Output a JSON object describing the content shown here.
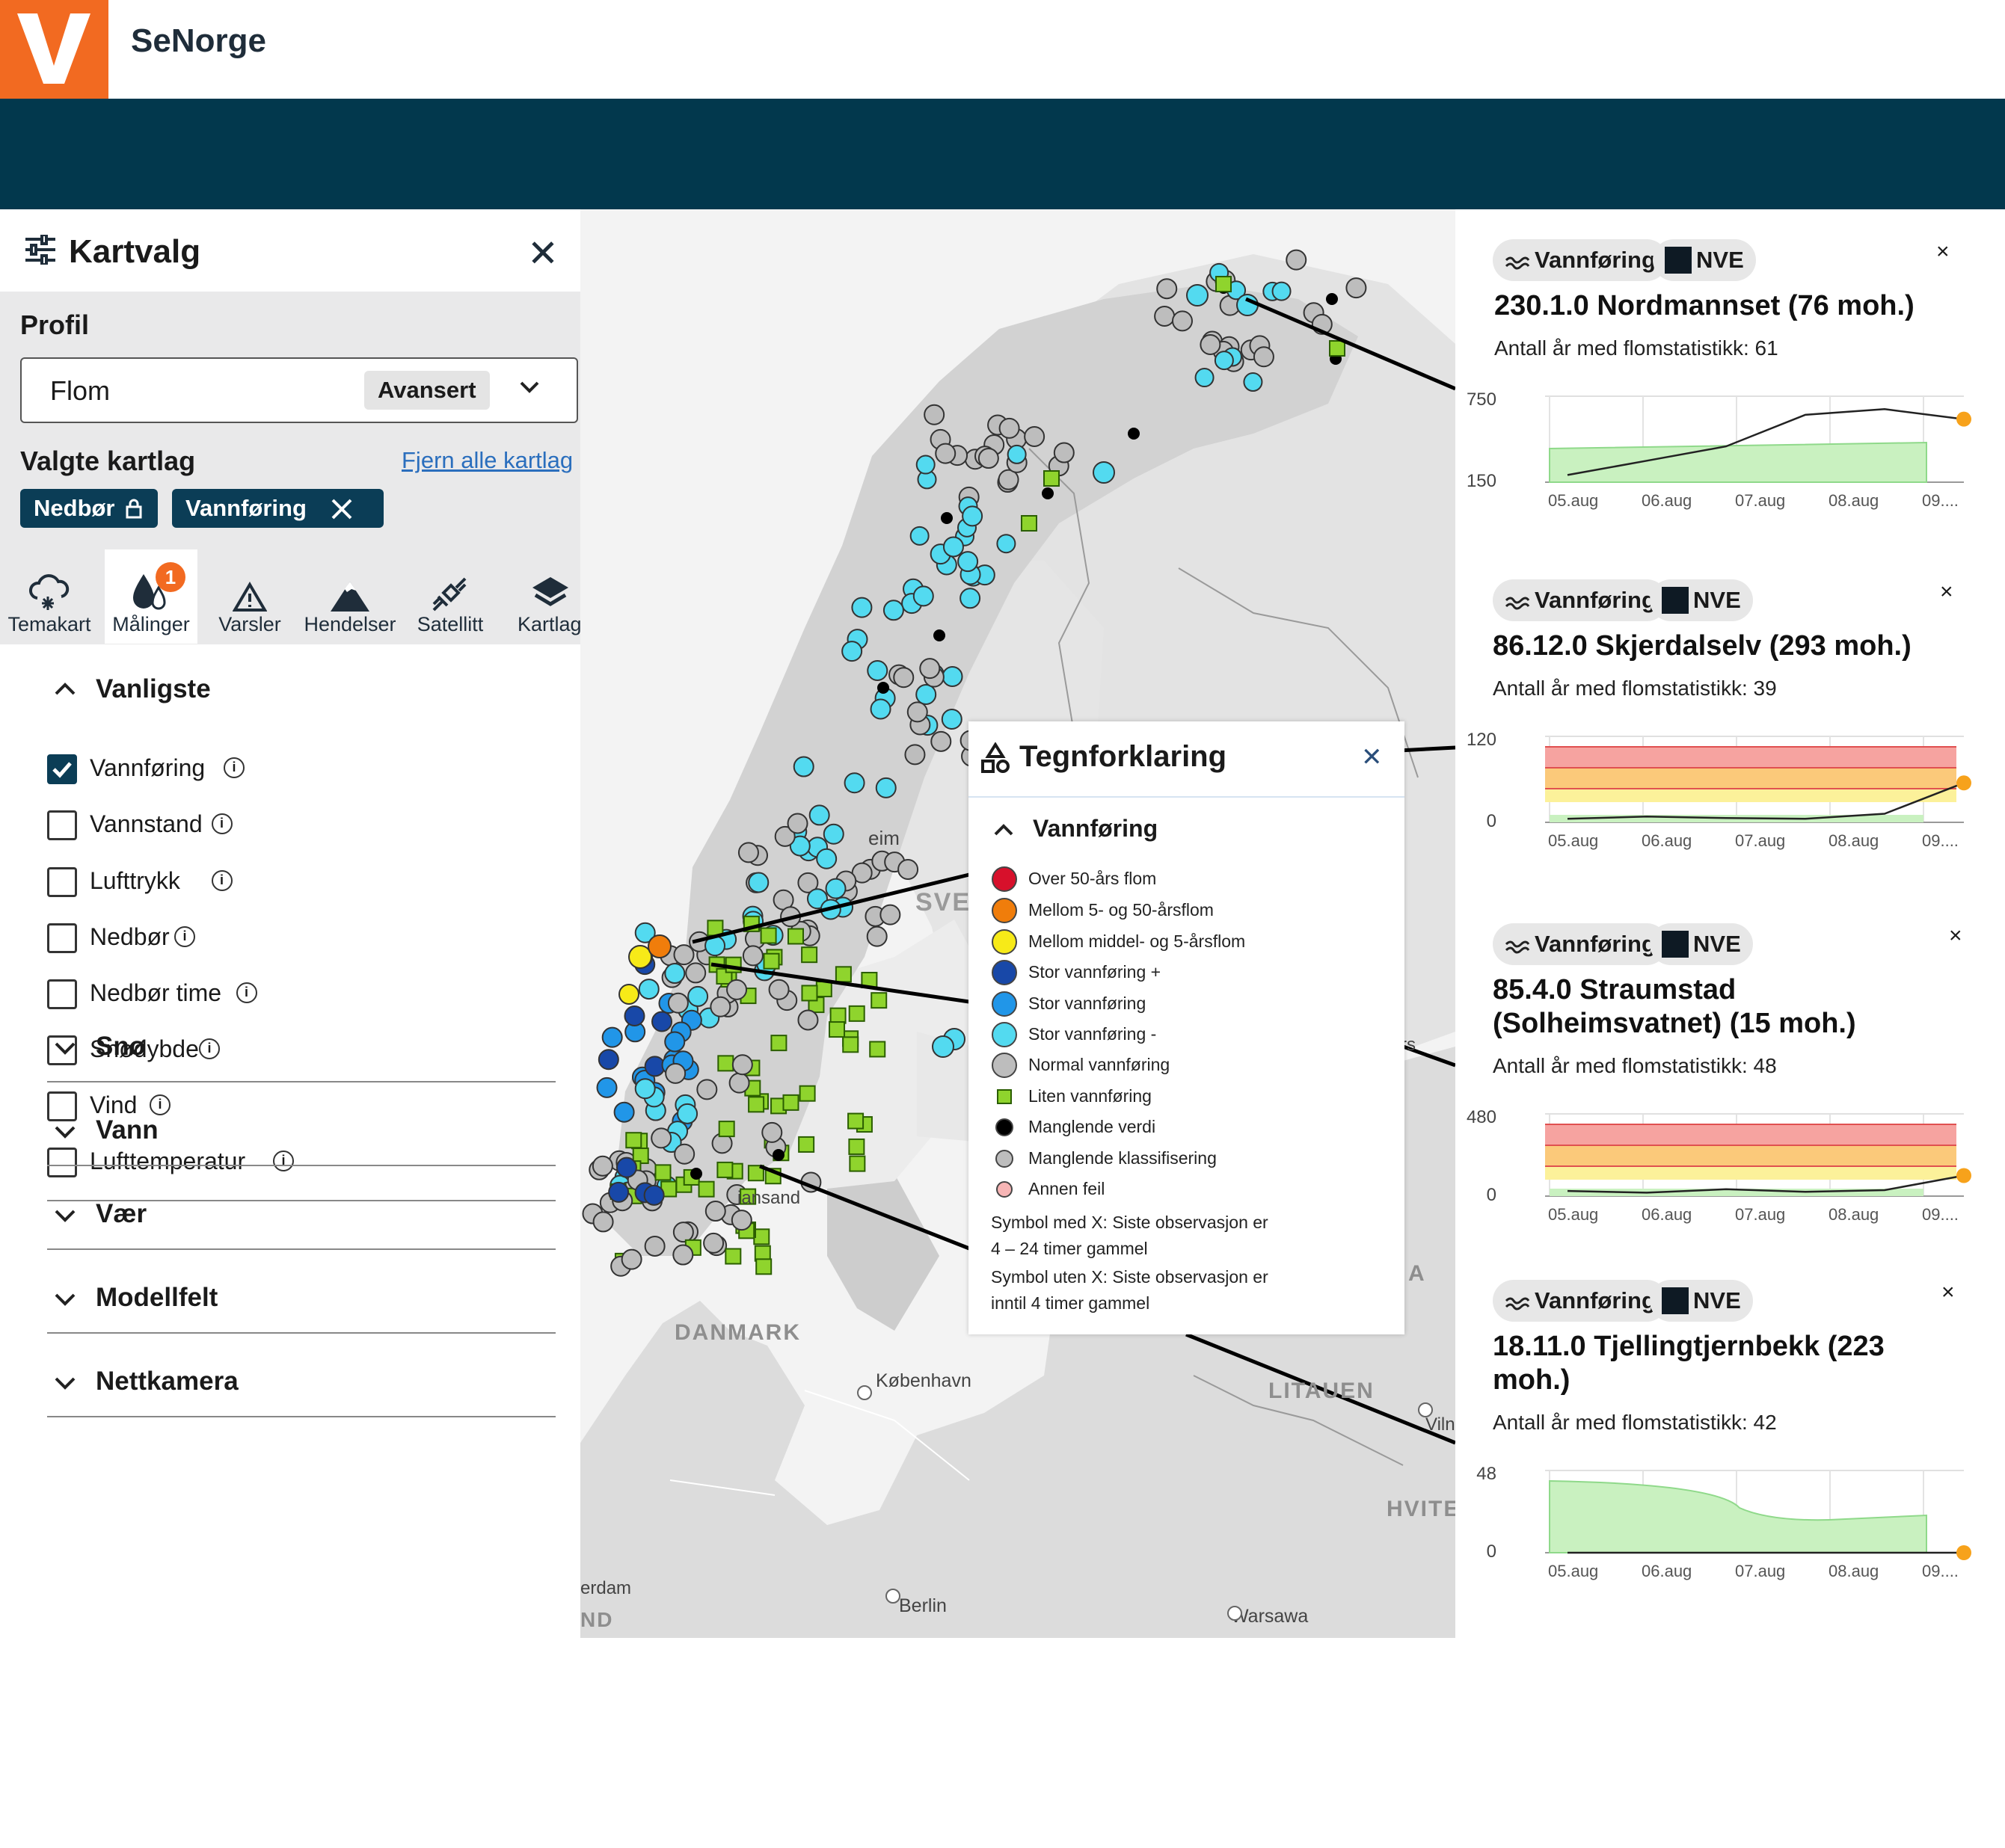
{
  "app": {
    "title": "SeNorge"
  },
  "sidebar": {
    "title": "Kartvalg",
    "profile_label": "Profil",
    "profile_value": "Flom",
    "profile_mode": "Avansert",
    "selected_layers_label": "Valgte kartlag",
    "remove_all": "Fjern alle kartlag",
    "chips": [
      {
        "label": "Nedbør"
      },
      {
        "label": "Vannføring"
      }
    ],
    "tabs": [
      {
        "label": "Temakart",
        "icon": "cloud-snow-icon"
      },
      {
        "label": "Målinger",
        "icon": "drops-icon",
        "badge": "1"
      },
      {
        "label": "Varsler",
        "icon": "warning-icon"
      },
      {
        "label": "Hendelser",
        "icon": "mountain-icon"
      },
      {
        "label": "Satellitt",
        "icon": "satellite-icon"
      },
      {
        "label": "Kartlag",
        "icon": "layers-icon"
      }
    ],
    "common_section": "Vanligste",
    "options": [
      {
        "label": "Vannføring",
        "checked": true
      },
      {
        "label": "Vannstand",
        "checked": false
      },
      {
        "label": "Lufttrykk",
        "checked": false
      },
      {
        "label": "Nedbør",
        "checked": false
      },
      {
        "label": "Nedbør time",
        "checked": false
      },
      {
        "label": "Snødybde",
        "checked": false
      },
      {
        "label": "Vind",
        "checked": false
      },
      {
        "label": "Lufttemperatur",
        "checked": false
      }
    ],
    "sections": [
      "Snø",
      "Vann",
      "Vær",
      "Modellfelt",
      "Nettkamera"
    ]
  },
  "map": {
    "labels": [
      "SVEI",
      "eim",
      "DANMARK",
      "København",
      "LITAUEN",
      "Vilnius",
      "HVITE",
      "Berlin",
      "Warsawa",
      "erdam",
      "ND",
      "iansand",
      "rs",
      "A"
    ]
  },
  "legend": {
    "title": "Tegnforklaring",
    "section": "Vannføring",
    "items": [
      {
        "label": "Over 50-års flom",
        "color": "#d7102b"
      },
      {
        "label": "Mellom 5- og 50-årsflom",
        "color": "#f07d0b"
      },
      {
        "label": "Mellom middel- og 5-årsflom",
        "color": "#f7ea18"
      },
      {
        "label": "Stor vannføring +",
        "color": "#1848a8"
      },
      {
        "label": "Stor vannføring",
        "color": "#2196e8"
      },
      {
        "label": "Stor vannføring -",
        "color": "#53daf0"
      },
      {
        "label": "Normal vannføring",
        "color": "#bdbdbd"
      },
      {
        "label": "Liten vannføring",
        "color": "#8fd42d"
      },
      {
        "label": "Manglende verdi",
        "color": "#000000"
      },
      {
        "label": "Manglende klassifisering",
        "color": "#bdbdbd"
      },
      {
        "label": "Annen feil",
        "color": "#f7b5b5"
      }
    ],
    "note1_line1": "Symbol med X: Siste observasjon er",
    "note1_line2": "4 – 24 timer gammel",
    "note2_line1": "Symbol uten X: Siste observasjon er",
    "note2_line2": "inntil 4 timer gammel"
  },
  "panels": [
    {
      "type": "Vannføring",
      "source": "NVE",
      "title_lines": [
        "230.1.0 Nordmannset (76 moh.)"
      ],
      "stat": "Antall år med flomstatistikk: 61",
      "ymax": "750",
      "ymin": "150",
      "dates": [
        "05.aug",
        "06.aug",
        "07.aug",
        "08.aug",
        "09...."
      ]
    },
    {
      "type": "Vannføring",
      "source": "NVE",
      "title_lines": [
        "86.12.0 Skjerdalselv (293 moh.)"
      ],
      "stat": "Antall år med flomstatistikk: 39",
      "ymax": "120",
      "ymin": "0",
      "dates": [
        "05.aug",
        "06.aug",
        "07.aug",
        "08.aug",
        "09...."
      ]
    },
    {
      "type": "Vannføring",
      "source": "NVE",
      "title_lines": [
        "85.4.0 Straumstad",
        "(Solheimsvatnet) (15 moh.)"
      ],
      "stat": "Antall år med flomstatistikk: 48",
      "ymax": "480",
      "ymin": "0",
      "dates": [
        "05.aug",
        "06.aug",
        "07.aug",
        "08.aug",
        "09...."
      ]
    },
    {
      "type": "Vannføring",
      "source": "NVE",
      "title_lines": [
        "18.11.0 Tjellingtjernbekk (223",
        "moh.)"
      ],
      "stat": "Antall år med flomstatistikk: 42",
      "ymax": "48",
      "ymin": "0",
      "dates": [
        "05.aug",
        "06.aug",
        "07.aug",
        "08.aug",
        "09...."
      ]
    }
  ],
  "chart_data": [
    {
      "type": "line",
      "title": "230.1.0 Nordmannset (76 moh.)",
      "ylim": [
        150,
        750
      ],
      "x": [
        "05.aug",
        "06.aug",
        "07.aug",
        "08.aug",
        "09...."
      ],
      "series": [
        {
          "values": [
            200,
            300,
            400,
            620,
            660,
            590
          ]
        }
      ]
    },
    {
      "type": "line",
      "title": "86.12.0 Skjerdalselv (293 moh.)",
      "ylim": [
        0,
        120
      ],
      "x": [
        "05.aug",
        "06.aug",
        "07.aug",
        "08.aug",
        "09...."
      ],
      "series": [
        {
          "values": [
            5,
            8,
            6,
            5,
            12,
            55
          ]
        }
      ]
    },
    {
      "type": "line",
      "title": "85.4.0 Straumstad (Solheimsvatnet) (15 moh.)",
      "ylim": [
        0,
        480
      ],
      "x": [
        "05.aug",
        "06.aug",
        "07.aug",
        "08.aug",
        "09...."
      ],
      "series": [
        {
          "values": [
            30,
            20,
            40,
            25,
            35,
            120
          ]
        }
      ]
    },
    {
      "type": "line",
      "title": "18.11.0 Tjellingtjernbekk (223 moh.)",
      "ylim": [
        0,
        48
      ],
      "x": [
        "05.aug",
        "06.aug",
        "07.aug",
        "08.aug",
        "09...."
      ],
      "series": [
        {
          "values": [
            0,
            0,
            0,
            0,
            0,
            0
          ]
        }
      ]
    }
  ]
}
